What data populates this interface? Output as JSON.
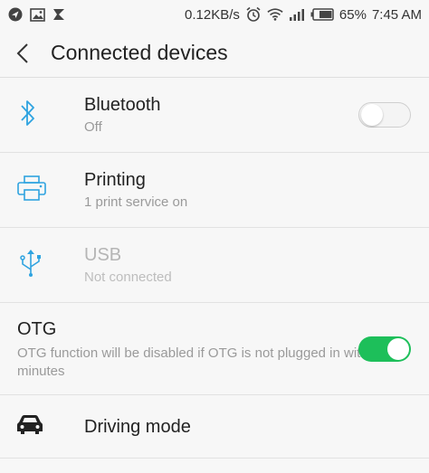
{
  "status_bar": {
    "speed": "0.12KB/s",
    "battery": "65%",
    "time": "7:45 AM"
  },
  "header": {
    "title": "Connected devices"
  },
  "items": {
    "bluetooth": {
      "label": "Bluetooth",
      "sub": "Off",
      "enabled": false
    },
    "printing": {
      "label": "Printing",
      "sub": "1 print service on"
    },
    "usb": {
      "label": "USB",
      "sub": "Not connected"
    },
    "otg": {
      "label": "OTG",
      "sub": "OTG function will be disabled if OTG is not plugged in within 10 minutes",
      "enabled": true
    },
    "driving": {
      "label": "Driving mode"
    }
  },
  "colors": {
    "accent_blue": "#2fa3e0",
    "toggle_on": "#1dbf5a"
  }
}
